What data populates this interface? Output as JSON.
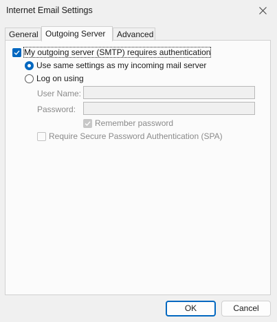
{
  "window": {
    "title": "Internet Email Settings"
  },
  "tabs": [
    {
      "label": "General",
      "active": false
    },
    {
      "label": "Outgoing Server",
      "active": true
    },
    {
      "label": "Advanced",
      "active": false
    }
  ],
  "outgoing": {
    "require_auth": {
      "label": "My outgoing server (SMTP) requires authentication",
      "checked": true
    },
    "use_same": {
      "label": "Use same settings as my incoming mail server",
      "selected": true
    },
    "log_on": {
      "label": "Log on using",
      "selected": false
    },
    "user_name": {
      "label": "User Name:",
      "value": ""
    },
    "password": {
      "label": "Password:",
      "value": ""
    },
    "remember_password": {
      "label": "Remember password",
      "checked": true,
      "enabled": false
    },
    "spa": {
      "label": "Require Secure Password Authentication (SPA)",
      "checked": false,
      "enabled": false
    }
  },
  "buttons": {
    "ok": "OK",
    "cancel": "Cancel"
  },
  "colors": {
    "accent": "#0067c0",
    "disabled_text": "#8a8a8a",
    "window_bg": "#f0f0f0"
  }
}
